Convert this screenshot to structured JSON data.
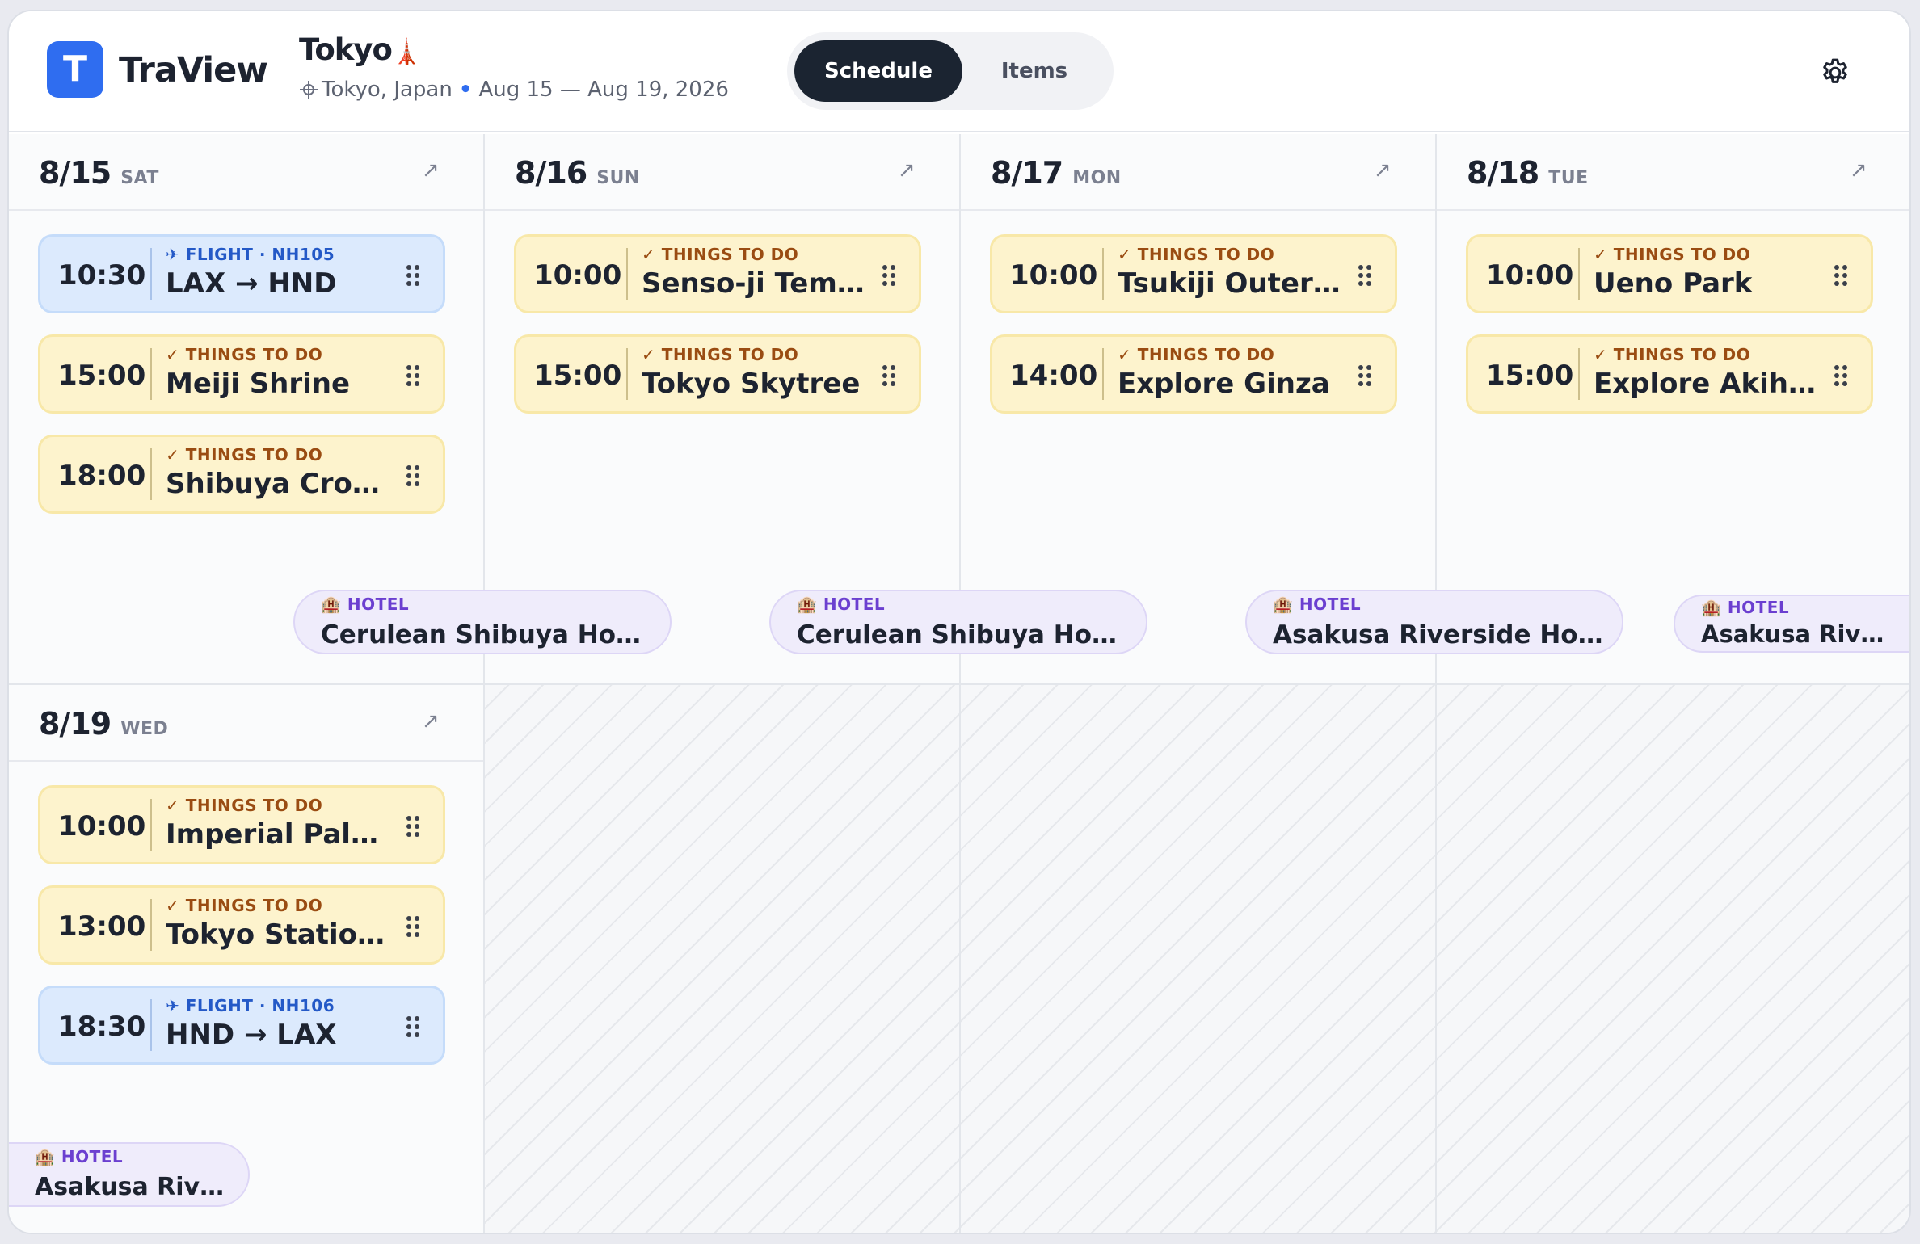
{
  "app": {
    "logo_letter": "T",
    "name": "TraView"
  },
  "trip": {
    "title": "Tokyo",
    "emoji": "🗼",
    "location": "Tokyo, Japan",
    "dates": "Aug 15 — Aug 19, 2026"
  },
  "tabs": {
    "schedule": "Schedule",
    "items": "Items",
    "active": "Schedule"
  },
  "icons": {
    "settings": "gear-icon",
    "expand": "arrow-up-right-icon",
    "drag": "drag-handle-icon",
    "location": "crosshair-icon",
    "hotel": "building-icon",
    "flight": "plane-icon",
    "todo": "check-icon"
  },
  "colors": {
    "accent": "#2f6df0",
    "todo_bg": "#fdf3cd",
    "flight_bg": "#dceafd",
    "hotel_bg": "#efecfb"
  },
  "days": [
    {
      "date": "8/15",
      "dow": "SAT",
      "expand": "↗",
      "items": [
        {
          "time": "10:30",
          "tag": "✈ FLIGHT · NH105",
          "title": "LAX → HND"
        },
        {
          "time": "15:00",
          "tag": "✓ THINGS TO DO",
          "title": "Meiji Shrine"
        },
        {
          "time": "18:00",
          "tag": "✓ THINGS TO DO",
          "title": "Shibuya Crossing"
        }
      ],
      "hotel": {
        "tag": "HOTEL",
        "name": "Cerulean Shibuya Hotel"
      }
    },
    {
      "date": "8/16",
      "dow": "SUN",
      "expand": "↗",
      "items": [
        {
          "time": "10:00",
          "tag": "✓ THINGS TO DO",
          "title": "Senso-ji Temple"
        },
        {
          "time": "15:00",
          "tag": "✓ THINGS TO DO",
          "title": "Tokyo Skytree"
        }
      ],
      "hotel": {
        "tag": "HOTEL",
        "name": "Cerulean Shibuya Hotel"
      }
    },
    {
      "date": "8/17",
      "dow": "MON",
      "expand": "↗",
      "items": [
        {
          "time": "10:00",
          "tag": "✓ THINGS TO DO",
          "title": "Tsukiji Outer Market"
        },
        {
          "time": "14:00",
          "tag": "✓ THINGS TO DO",
          "title": "Explore Ginza"
        }
      ],
      "hotel": {
        "tag": "HOTEL",
        "name": "Asakusa Riverside Hotel"
      }
    },
    {
      "date": "8/18",
      "dow": "TUE",
      "expand": "↗",
      "items": [
        {
          "time": "10:00",
          "tag": "✓ THINGS TO DO",
          "title": "Ueno Park"
        },
        {
          "time": "15:00",
          "tag": "✓ THINGS TO DO",
          "title": "Explore Akihabara"
        }
      ],
      "hotel": {
        "tag": "HOTEL",
        "name": "Asakusa Riverside Hotel"
      }
    },
    {
      "date": "8/19",
      "dow": "WED",
      "expand": "↗",
      "items": [
        {
          "time": "10:00",
          "tag": "✓ THINGS TO DO",
          "title": "Imperial Palace"
        },
        {
          "time": "13:00",
          "tag": "✓ THINGS TO DO",
          "title": "Tokyo Station Area"
        },
        {
          "time": "18:30",
          "tag": "✈ FLIGHT · NH106",
          "title": "HND → LAX"
        }
      ],
      "hotel": {
        "tag": "HOTEL",
        "name": "Asakusa Riverside Hotel"
      }
    }
  ]
}
